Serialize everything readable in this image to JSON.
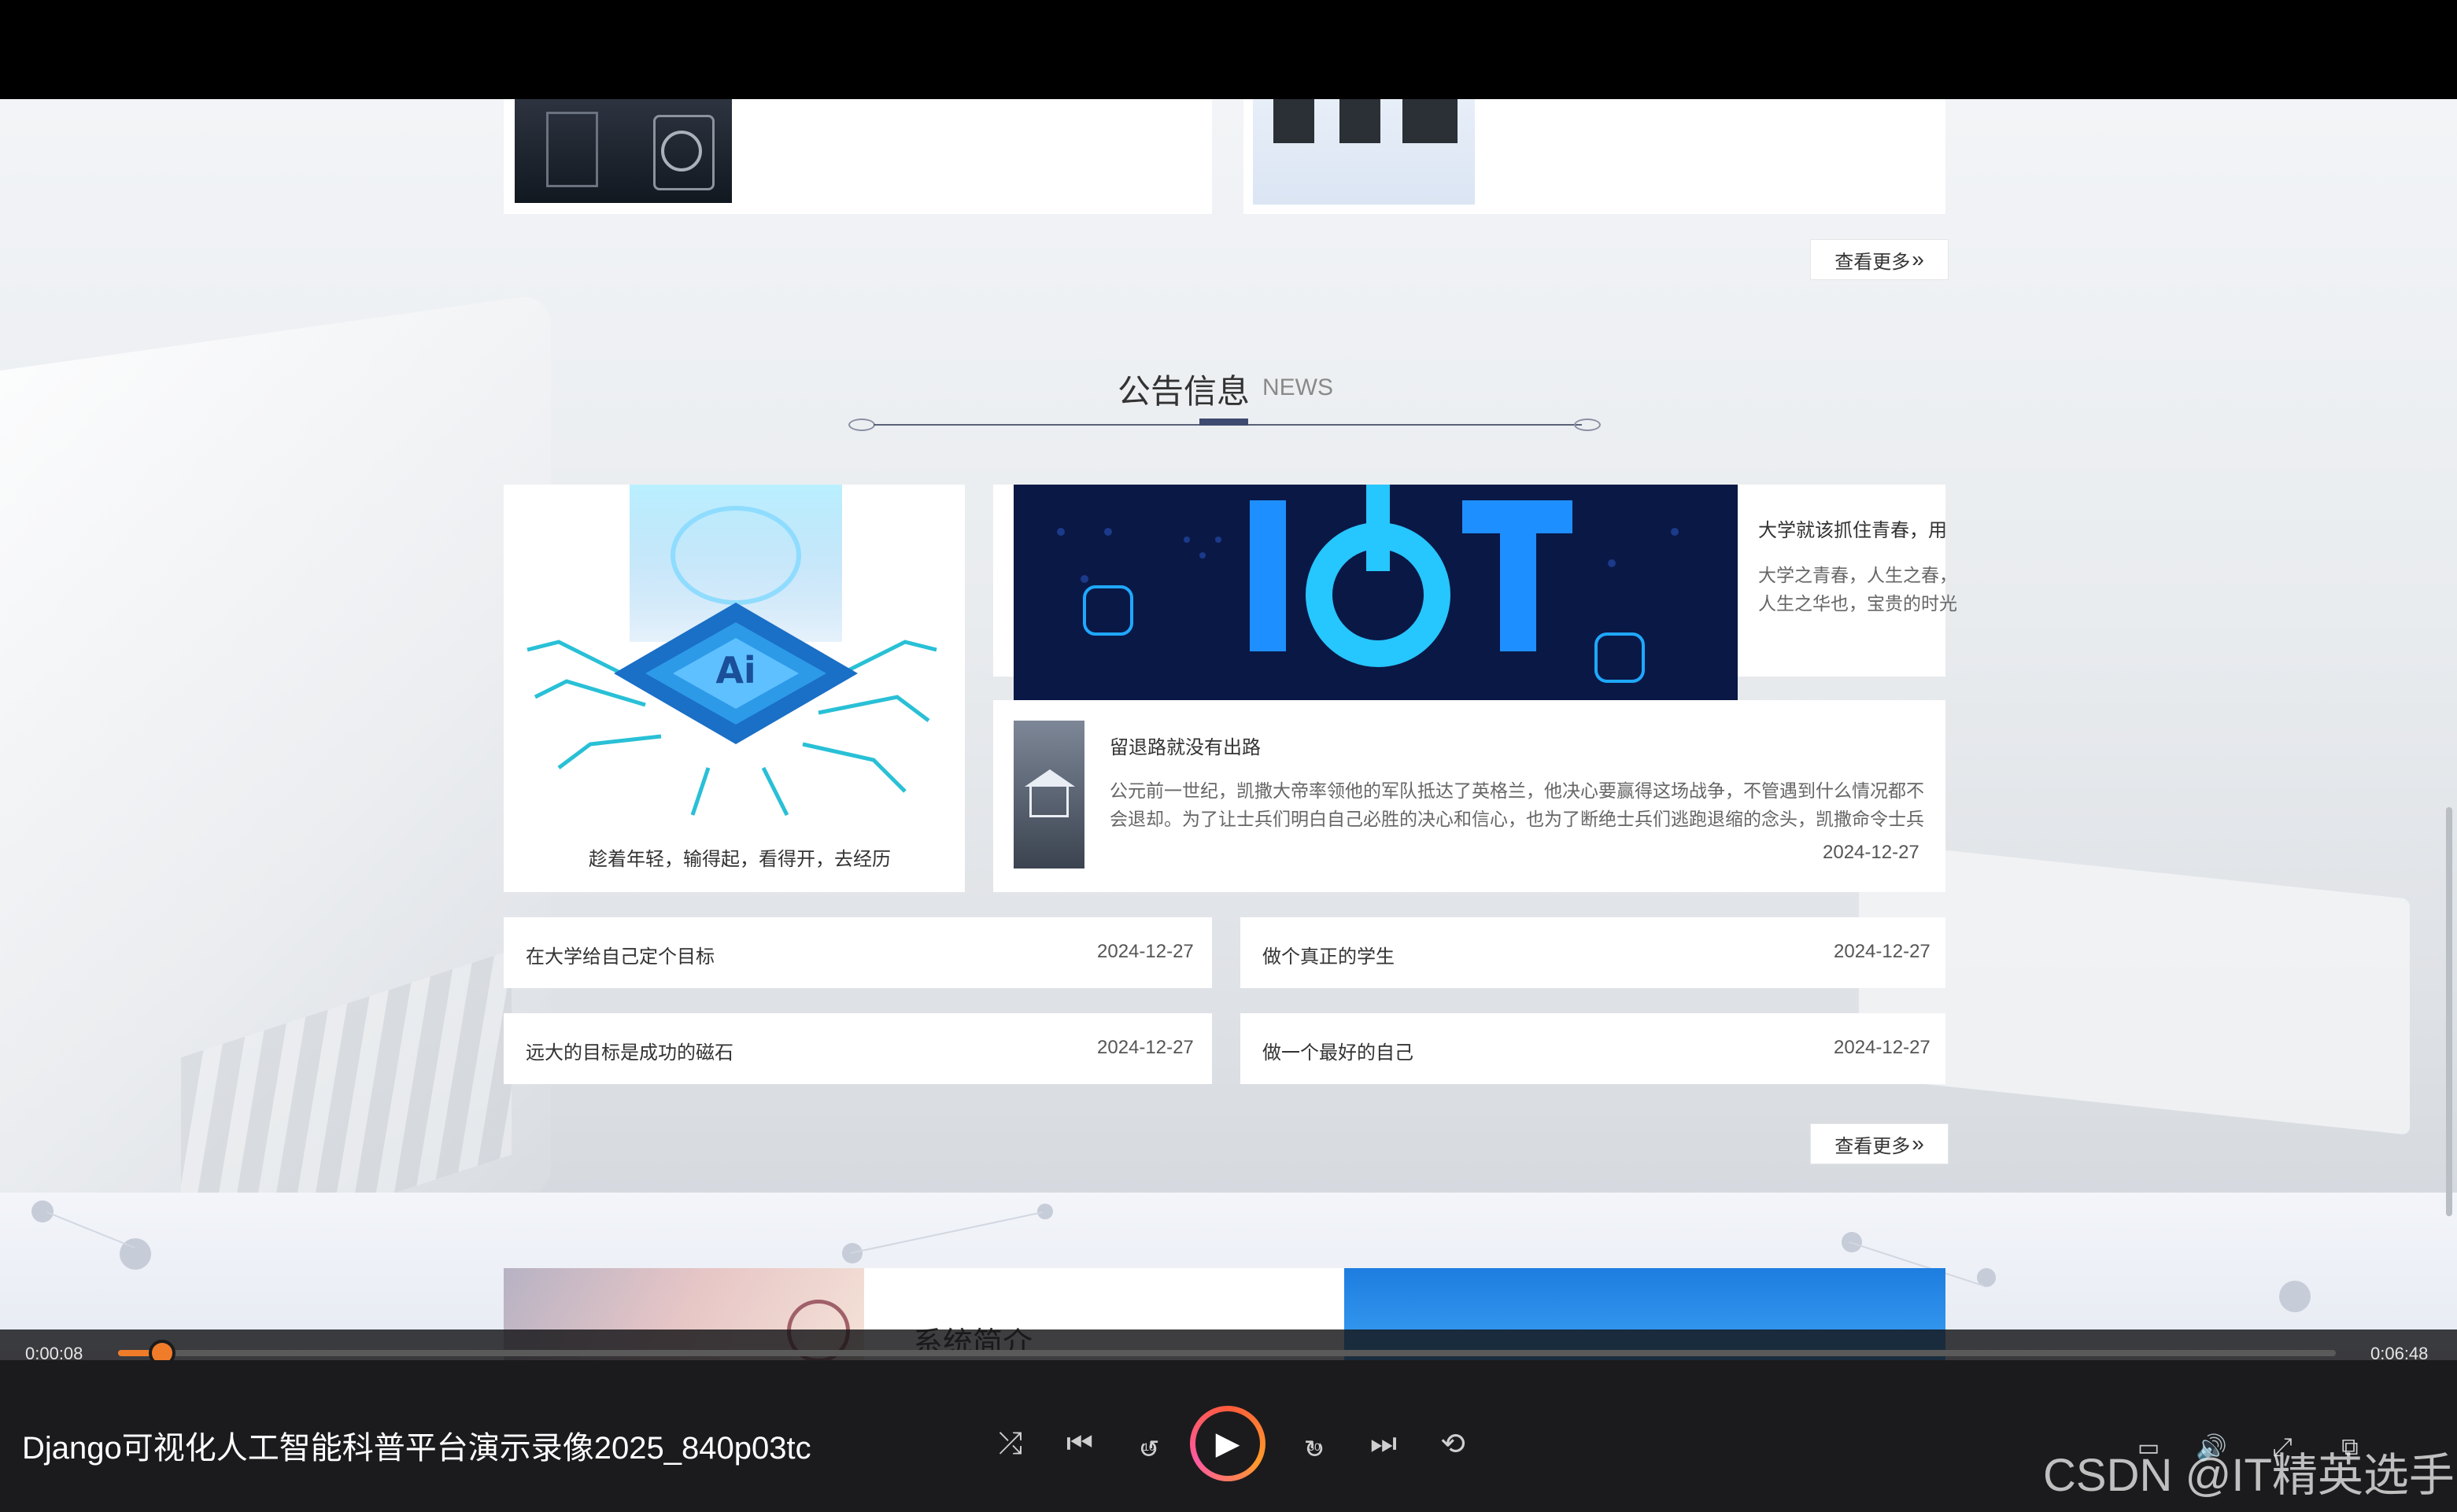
{
  "window": {
    "video_title": "Django可视化人工智能科普平台演示录像2025_840p03tc",
    "watermark": "CSDN @IT精英选手"
  },
  "top_section": {
    "view_more": "查看更多"
  },
  "news": {
    "title": "公告信息",
    "subtitle": "NEWS",
    "feature_caption": "趁着年轻，输得起，看得开，去经历",
    "banner_text": "IOT",
    "banner_side_title": "大学就该抓住青春，用",
    "banner_side_text": [
      "大学之青春，人生之春，",
      "人生之华也，宝贵的时光"
    ],
    "article": {
      "title": "留退路就没有出路",
      "excerpt": [
        "公元前一世纪，凯撒大帝率领他的军队抵达了英格兰，他决心要赢得这场战争，不管遇到什么情况都不",
        "会退却。为了让士兵们明白自己必胜的决心和信心，也为了断绝士兵们逃跑退缩的念头，凯撒命令士兵"
      ],
      "date": "2024-12-27"
    },
    "list": [
      {
        "title": "在大学给自己定个目标",
        "date": "2024-12-27"
      },
      {
        "title": "做个真正的学生",
        "date": "2024-12-27"
      },
      {
        "title": "远大的目标是成功的磁石",
        "date": "2024-12-27"
      },
      {
        "title": "做一个最好的自己",
        "date": "2024-12-27"
      }
    ],
    "view_more": "查看更多"
  },
  "intro": {
    "title": "系统简介"
  },
  "player": {
    "current_time": "0:00:08",
    "total_time": "0:06:48",
    "progress": 0.02,
    "rewind_label": "10",
    "forward_label": "30"
  },
  "colors": {
    "accent": "#f07c2a",
    "title_accent": "#3f4a70"
  }
}
